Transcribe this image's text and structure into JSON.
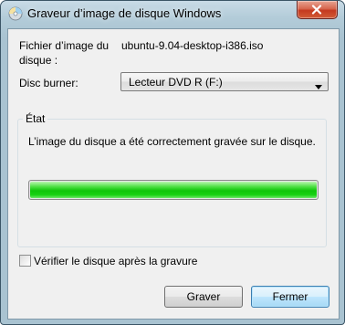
{
  "window": {
    "title": "Graveur d’image de disque Windows"
  },
  "form": {
    "file_label": "Fichier d’image du disque :",
    "file_value": "ubuntu-9.04-desktop-i386.iso",
    "burner_label": "Disc burner:",
    "burner_selected": "Lecteur DVD R (F:)"
  },
  "status_group": {
    "title": "État",
    "message": "L’image du disque a été correctement gravée sur le disque.",
    "progress_percent": 100
  },
  "options": {
    "verify_label": "Vérifier le disque après la gravure",
    "verify_checked": false
  },
  "buttons": {
    "burn_label": "Graver",
    "close_label": "Fermer"
  },
  "icons": {
    "app": "disc-burner-icon",
    "close": "close-icon",
    "dropdown": "chevron-down-icon"
  },
  "colors": {
    "progress": "#17d212",
    "close_button": "#c4391f"
  }
}
